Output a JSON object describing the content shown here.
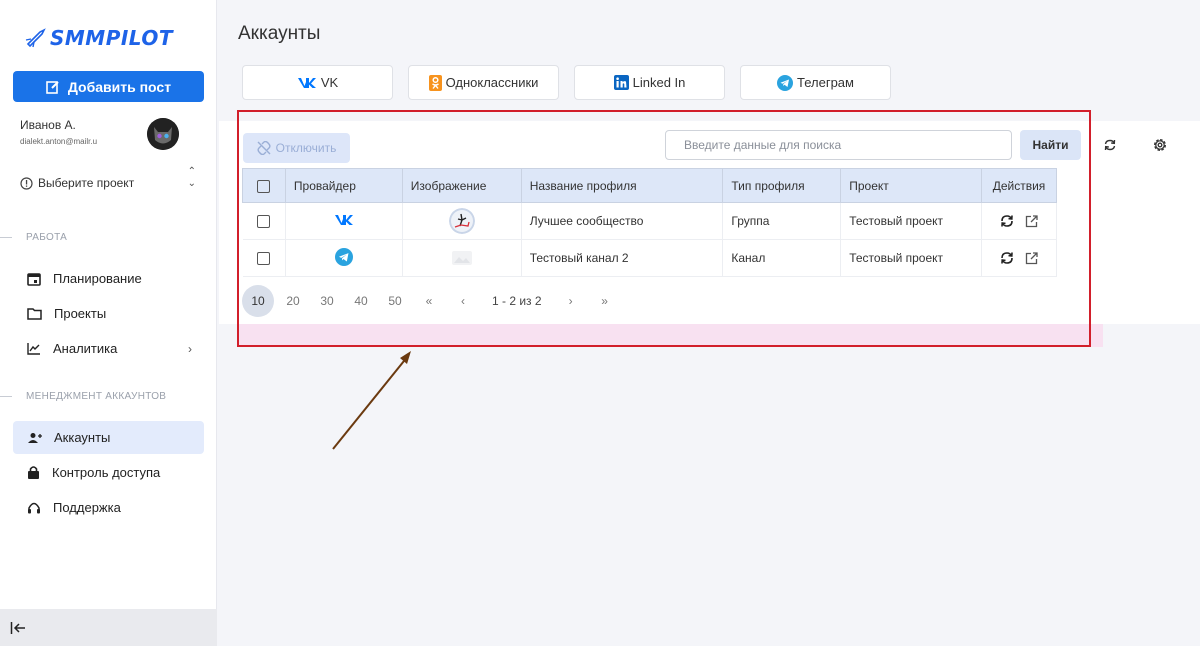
{
  "sidebar": {
    "logo_text": "SMMPILOT",
    "add_post_label": "Добавить пост",
    "user": {
      "name": "Иванов А.",
      "email": "dialekt.anton@mailr.u"
    },
    "project_select": "Выберите проект",
    "section_work": "РАБОТА",
    "nav_work": [
      {
        "label": "Планирование",
        "icon": "calendar-icon"
      },
      {
        "label": "Проекты",
        "icon": "folder-icon"
      },
      {
        "label": "Аналитика",
        "icon": "chart-icon"
      }
    ],
    "section_accounts": "МЕНЕДЖМЕНТ АККАУНТОВ",
    "nav_accounts": [
      {
        "label": "Аккаунты",
        "icon": "add-user-icon",
        "active": true
      },
      {
        "label": "Контроль доступа",
        "icon": "lock-icon"
      },
      {
        "label": "Поддержка",
        "icon": "headset-icon"
      }
    ]
  },
  "main": {
    "title": "Аккаунты",
    "tabs": [
      {
        "label": "VK",
        "icon": "vk-icon",
        "color": "#0077ff"
      },
      {
        "label": "Одноклассники",
        "icon": "ok-icon",
        "color": "#f7931e"
      },
      {
        "label": "Linked In",
        "icon": "linkedin-icon",
        "color": "#0a66c2"
      },
      {
        "label": "Телеграм",
        "icon": "telegram-icon",
        "color": "#2aa3df"
      }
    ],
    "disconnect_label": "Отключить",
    "search_placeholder": "Введите данные для поиска",
    "find_label": "Найти",
    "table": {
      "headers": [
        "Провайдер",
        "Изображение",
        "Название профиля",
        "Тип профиля",
        "Проект",
        "Действия"
      ],
      "rows": [
        {
          "provider": "vk-icon",
          "name": "Лучшее сообщество",
          "type": "Группа",
          "project": "Тестовый проект"
        },
        {
          "provider": "telegram-icon",
          "name": "Тестовый канал 2",
          "type": "Канал",
          "project": "Тестовый проект"
        }
      ]
    },
    "pager": {
      "sizes": [
        "10",
        "20",
        "30",
        "40",
        "50"
      ],
      "active_size": "10",
      "first": "«",
      "prev": "‹",
      "info": "1 - 2 из 2",
      "next": "›",
      "last": "»"
    }
  },
  "colors": {
    "accent": "#1a73e8",
    "highlight": "#d21f2b",
    "active_nav": "#e3ebfc"
  }
}
